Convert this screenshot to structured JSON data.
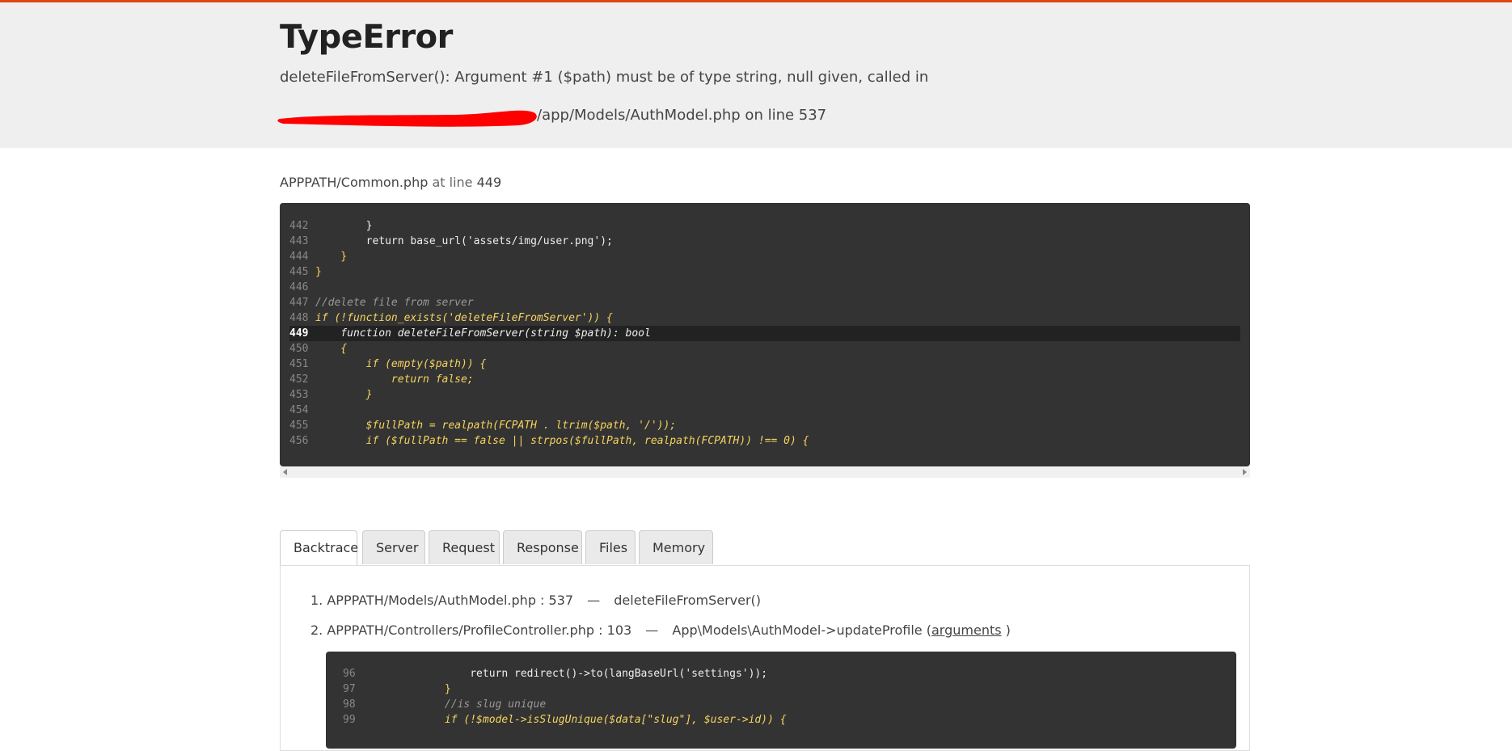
{
  "error": {
    "title": "TypeError",
    "message_line1": "deleteFileFromServer(): Argument #1 ($path) must be of type string, null given, called in",
    "message_line2": "/app/Models/AuthModel.php on line 537"
  },
  "location": {
    "file": "APPPATH/Common.php",
    "at_line_label": "at line",
    "line": "449"
  },
  "source": {
    "lines": [
      {
        "n": "442",
        "text": "        }"
      },
      {
        "n": "443",
        "text": "        return base_url('assets/img/user.png');"
      },
      {
        "n": "444",
        "text": "    }"
      },
      {
        "n": "445",
        "text": "}"
      },
      {
        "n": "446",
        "text": ""
      },
      {
        "n": "447",
        "text": "//delete file from server"
      },
      {
        "n": "448",
        "text": "if (!function_exists('deleteFileFromServer')) {"
      },
      {
        "n": "449",
        "text": "    function deleteFileFromServer(string $path): bool"
      },
      {
        "n": "450",
        "text": "    {"
      },
      {
        "n": "451",
        "text": "        if (empty($path)) {"
      },
      {
        "n": "452",
        "text": "            return false;"
      },
      {
        "n": "453",
        "text": "        }"
      },
      {
        "n": "454",
        "text": ""
      },
      {
        "n": "455",
        "text": "        $fullPath = realpath(FCPATH . ltrim($path, '/'));"
      },
      {
        "n": "456",
        "text": "        if ($fullPath == false || strpos($fullPath, realpath(FCPATH)) !== 0) {"
      }
    ]
  },
  "tabs": [
    {
      "label": "Backtrace"
    },
    {
      "label": "Server"
    },
    {
      "label": "Request"
    },
    {
      "label": "Response"
    },
    {
      "label": "Files"
    },
    {
      "label": "Memory"
    }
  ],
  "backtrace": [
    {
      "index": "1.",
      "file": "APPPATH/Models/AuthModel.php : 537",
      "sep": "—",
      "call": "deleteFileFromServer()",
      "args_open": "",
      "args": "",
      "args_close": ""
    },
    {
      "index": "2.",
      "file": "APPPATH/Controllers/ProfileController.php : 103",
      "sep": "—",
      "call": "App\\Models\\AuthModel->updateProfile",
      "args_open": "(",
      "args": "arguments",
      "args_close": ")"
    }
  ],
  "source2": {
    "lines": [
      {
        "n": "96",
        "text": "                return redirect()->to(langBaseUrl('settings'));"
      },
      {
        "n": "97",
        "text": "            }"
      },
      {
        "n": "98",
        "text": "            //is slug unique"
      },
      {
        "n": "99",
        "text": "            if (!$model->isSlugUnique($data[\"slug\"], $user->id)) {"
      }
    ]
  }
}
